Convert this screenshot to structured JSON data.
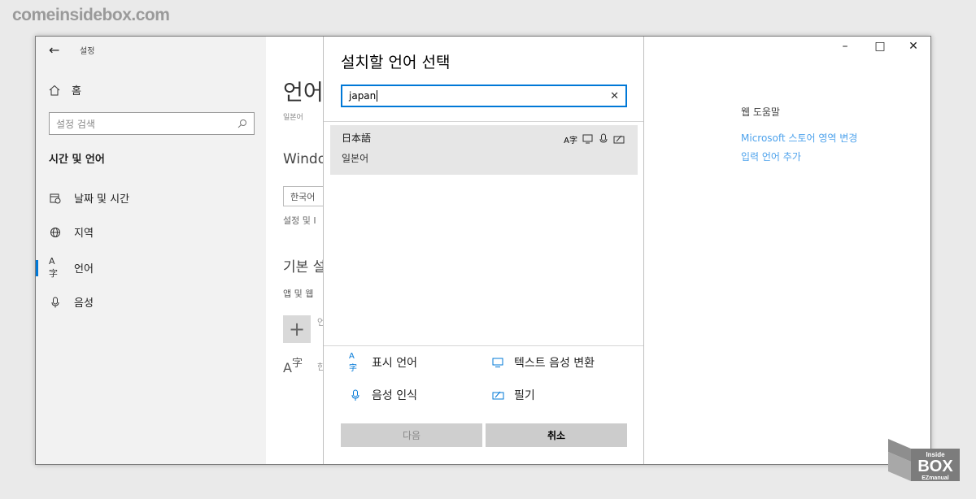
{
  "watermark": "comeinsidebox.com",
  "sidebar": {
    "back_title": "설정",
    "home_label": "홈",
    "search_placeholder": "설정 검색",
    "section_title": "시간 및 언어",
    "items": [
      {
        "label": "날짜 및 시간",
        "icon": "calendar-clock-icon"
      },
      {
        "label": "지역",
        "icon": "globe-icon"
      },
      {
        "label": "언어",
        "icon": "language-icon",
        "active": true
      },
      {
        "label": "음성",
        "icon": "microphone-icon"
      }
    ]
  },
  "content": {
    "title": "언어",
    "title_sub": "일본어",
    "windows_heading": "Windo",
    "lang_select_value": "한국어",
    "settings_text": "설정 및 I",
    "default_heading": "기본 설",
    "apps_text": "앱 및 웹",
    "add_fragment": "언",
    "lang_icon_text": "字",
    "lang_fragment": "한"
  },
  "dialog": {
    "title": "설치할 언어 선택",
    "search_value": "japan",
    "result": {
      "native_name": "日本語",
      "local_name": "일본어",
      "feature_icons": [
        "display-language-icon",
        "text-to-speech-icon",
        "speech-recognition-icon",
        "handwriting-icon"
      ]
    },
    "legend": [
      {
        "label": "표시 언어",
        "icon": "display-language-icon"
      },
      {
        "label": "텍스트 음성 변환",
        "icon": "text-to-speech-icon"
      },
      {
        "label": "음성 인식",
        "icon": "speech-recognition-icon"
      },
      {
        "label": "필기",
        "icon": "handwriting-icon"
      }
    ],
    "next_button": "다음",
    "cancel_button": "취소"
  },
  "right_pane": {
    "help_title": "웹 도움말",
    "links": [
      "Microsoft 스토어 영역 변경",
      "입력 언어 추가"
    ]
  },
  "window_controls": {
    "minimize": "–",
    "maximize": "□",
    "close": "✕"
  },
  "logo_text": {
    "top": "Inside",
    "main": "BOX",
    "bottom": "EZmanual"
  },
  "colors": {
    "accent": "#0078d7",
    "link": "#4fa3ec",
    "sidebar_bg": "#f2f2f2"
  }
}
